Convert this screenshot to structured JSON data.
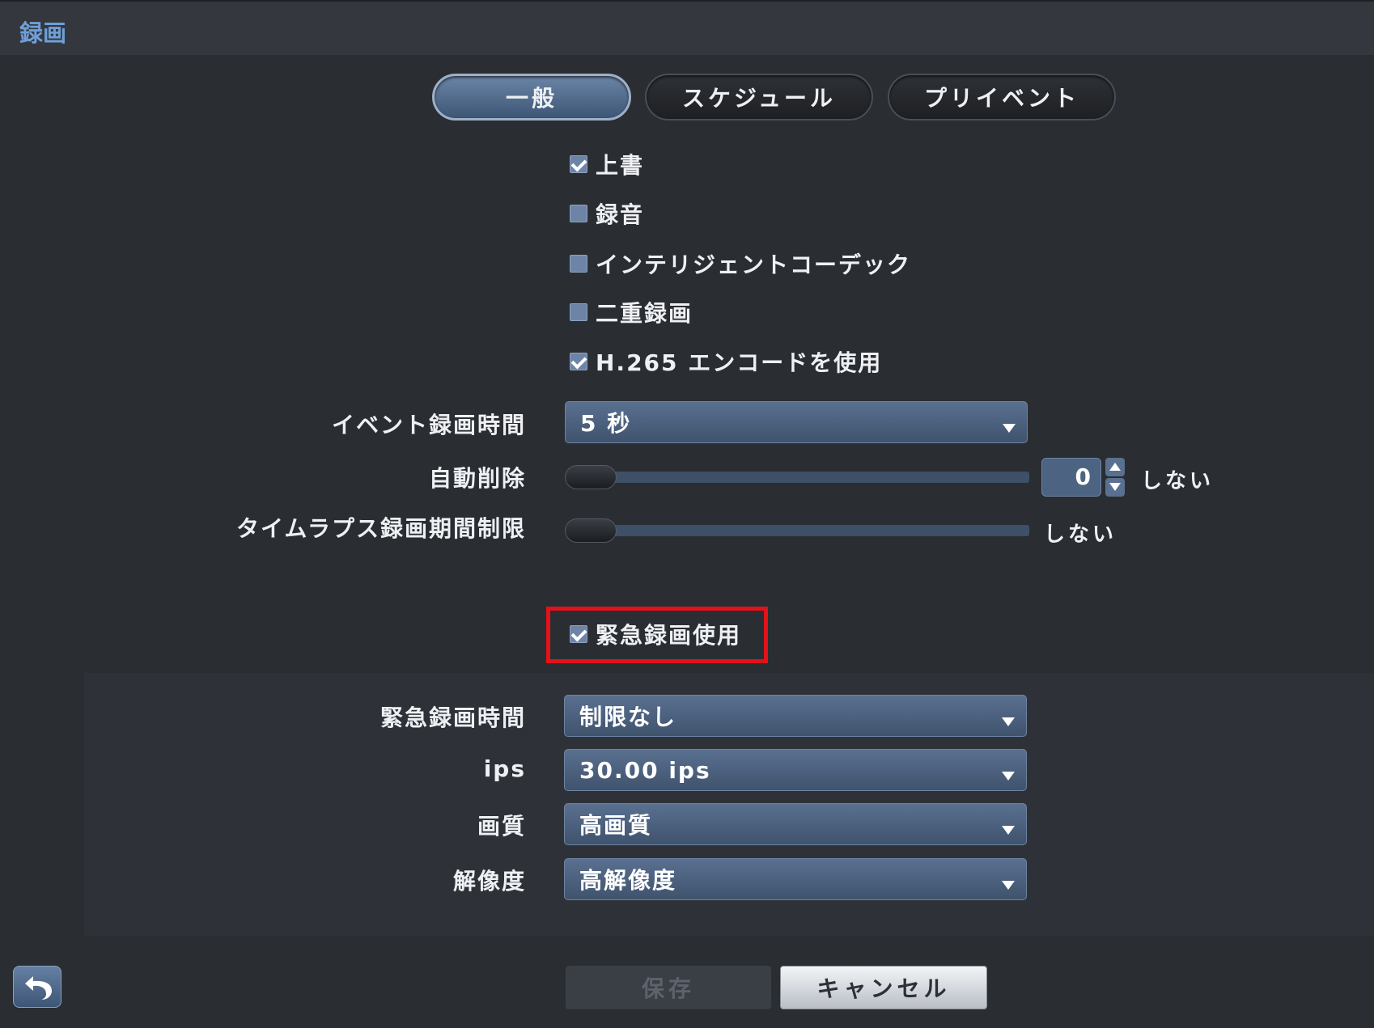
{
  "window": {
    "title": "録画"
  },
  "tabs": [
    {
      "label": "一般",
      "active": true
    },
    {
      "label": "スケジュール",
      "active": false
    },
    {
      "label": "プリイベント",
      "active": false
    }
  ],
  "options": [
    {
      "label": "上書",
      "checked": true
    },
    {
      "label": "録音",
      "checked": false
    },
    {
      "label": "インテリジェントコーデック",
      "checked": false
    },
    {
      "label": "二重録画",
      "checked": false
    },
    {
      "label": "H.265 エンコードを使用",
      "checked": true
    }
  ],
  "event_record_time": {
    "label": "イベント録画時間",
    "value": "5 秒"
  },
  "auto_delete": {
    "label": "自動削除",
    "value": "0",
    "unit": "しない"
  },
  "timelapse_limit": {
    "label": "タイムラプス録画期間制限",
    "unit": "しない"
  },
  "emergency": {
    "enable_label": "緊急録画使用",
    "enabled": true,
    "fields": [
      {
        "label": "緊急録画時間",
        "value": "制限なし"
      },
      {
        "label": "ips",
        "value": "30.00 ips"
      },
      {
        "label": "画質",
        "value": "高画質"
      },
      {
        "label": "解像度",
        "value": "高解像度"
      }
    ]
  },
  "footer": {
    "save_label": "保存",
    "cancel_label": "キャンセル"
  },
  "colors": {
    "accent": "#6f9fd8",
    "highlight": "#e3121a"
  },
  "icons": {
    "back": "back-arrow-icon",
    "dropdown": "chevron-down-icon"
  }
}
